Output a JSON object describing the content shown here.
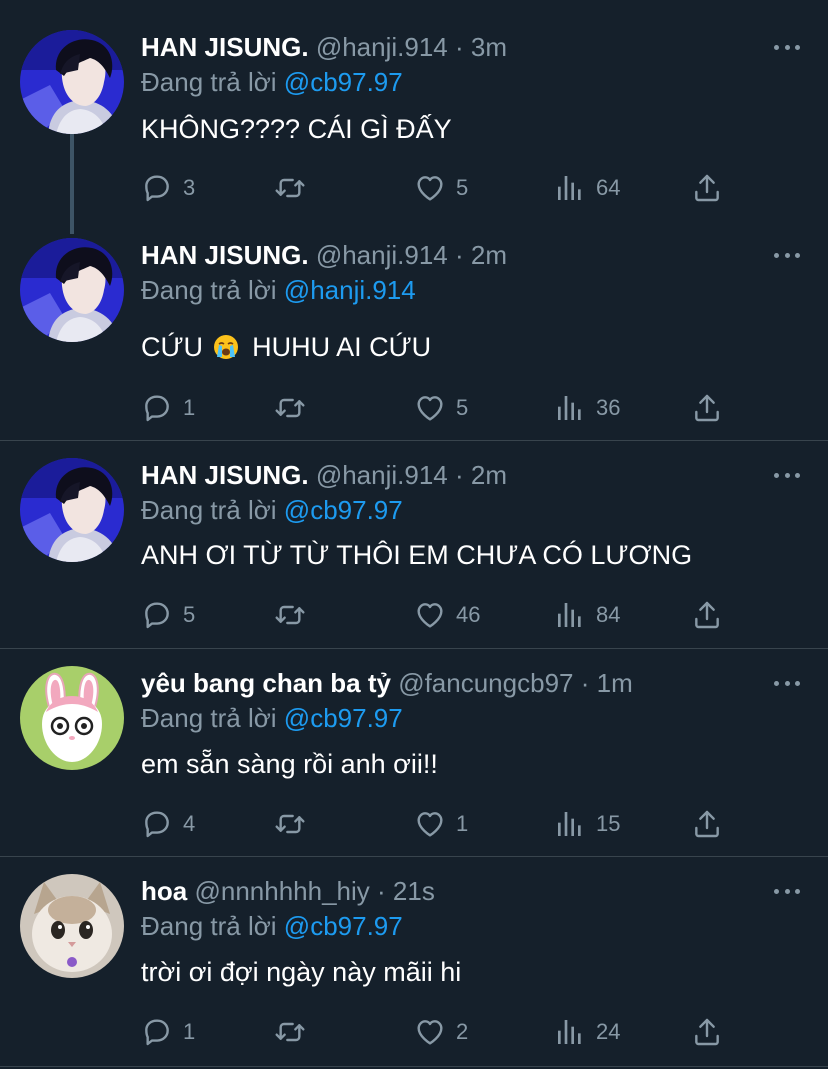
{
  "tweets": [
    {
      "name": "HAN JISUNG.",
      "handle": "@hanji.914",
      "dot": "·",
      "time": "3m",
      "reply_prefix": "Đang trả lời",
      "reply_to": "@cb97.97",
      "text": "KHÔNG???? CÁI GÌ ĐẤY",
      "replies": "3",
      "likes": "5",
      "views": "64",
      "avatar": "han-jisung-avatar"
    },
    {
      "name": "HAN JISUNG.",
      "handle": "@hanji.914",
      "dot": "·",
      "time": "2m",
      "reply_prefix": "Đang trả lời",
      "reply_to": "@hanji.914",
      "text_before": "CỨU",
      "emoji": "crying-face-emoji",
      "text_after": "HUHU AI CỨU",
      "replies": "1",
      "likes": "5",
      "views": "36",
      "avatar": "han-jisung-avatar"
    },
    {
      "name": "HAN JISUNG.",
      "handle": "@hanji.914",
      "dot": "·",
      "time": "2m",
      "reply_prefix": "Đang trả lời",
      "reply_to": "@cb97.97",
      "text": "ANH ƠI TỪ TỪ THÔI EM CHƯA CÓ LƯƠNG",
      "replies": "5",
      "likes": "46",
      "views": "84",
      "avatar": "han-jisung-avatar"
    },
    {
      "name": "yêu bang chan ba tỷ",
      "handle": "@fancungcb97",
      "dot": "·",
      "time": "1m",
      "reply_prefix": "Đang trả lời",
      "reply_to": "@cb97.97",
      "text": "em sẵn sàng rồi anh ơii!!",
      "replies": "4",
      "likes": "1",
      "views": "15",
      "avatar": "bunny-character-avatar"
    },
    {
      "name": "hoa",
      "handle": "@nnnhhhh_hiy",
      "dot": "·",
      "time": "21s",
      "reply_prefix": "Đang trả lời",
      "reply_to": "@cb97.97",
      "text": "trời ơi đợi ngày này mãii hi",
      "replies": "1",
      "likes": "2",
      "views": "24",
      "avatar": "cat-avatar"
    }
  ],
  "colors": {
    "background": "#15202b",
    "secondary_text": "#8899a6",
    "mention": "#1d9bf0",
    "divider": "#38444d"
  }
}
